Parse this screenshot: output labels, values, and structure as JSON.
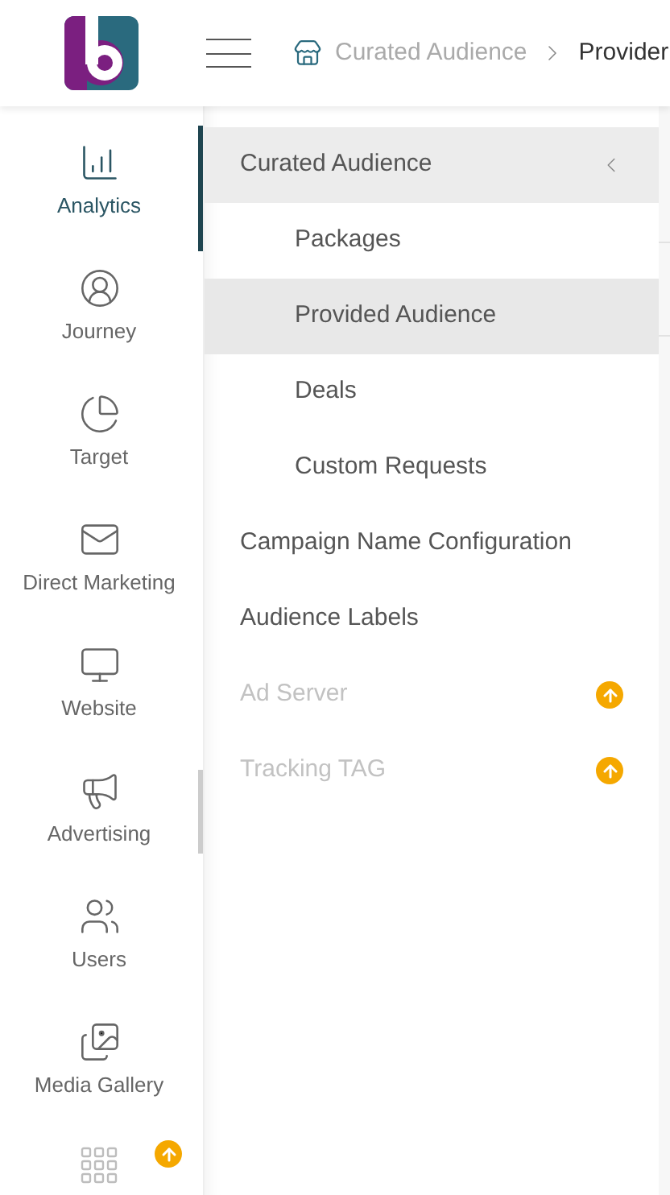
{
  "header": {
    "breadcrumb": [
      {
        "label": "Curated Audience",
        "current": false
      },
      {
        "label": "Provider",
        "current": true
      }
    ]
  },
  "sidebar": {
    "items": [
      {
        "kind": "analytics",
        "label": "Analytics",
        "selected": true
      },
      {
        "kind": "journey",
        "label": "Journey",
        "selected": false
      },
      {
        "kind": "target",
        "label": "Target",
        "selected": false
      },
      {
        "kind": "mail",
        "label": "Direct Marketing",
        "selected": false
      },
      {
        "kind": "website",
        "label": "Website",
        "selected": false
      },
      {
        "kind": "advertising",
        "label": "Advertising",
        "selected": false
      },
      {
        "kind": "users",
        "label": "Users",
        "selected": false
      },
      {
        "kind": "media",
        "label": "Media Gallery",
        "selected": false
      },
      {
        "kind": "apps",
        "upgrade": true,
        "selected": false
      }
    ]
  },
  "menu": {
    "items": [
      {
        "label": "Curated Audience",
        "expanded": true,
        "selected": false,
        "disabled": false,
        "upgrade": false,
        "children": [
          {
            "label": "Packages",
            "selected": false
          },
          {
            "label": "Provided Audience",
            "selected": true
          },
          {
            "label": "Deals",
            "selected": false
          },
          {
            "label": "Custom Requests",
            "selected": false
          }
        ]
      },
      {
        "label": "Campaign Name Configuration",
        "selected": false,
        "disabled": false,
        "upgrade": false
      },
      {
        "label": "Audience Labels",
        "selected": false,
        "disabled": false,
        "upgrade": false
      },
      {
        "label": "Ad Server",
        "selected": false,
        "disabled": true,
        "upgrade": true
      },
      {
        "label": "Tracking TAG",
        "selected": false,
        "disabled": true,
        "upgrade": true
      }
    ]
  }
}
